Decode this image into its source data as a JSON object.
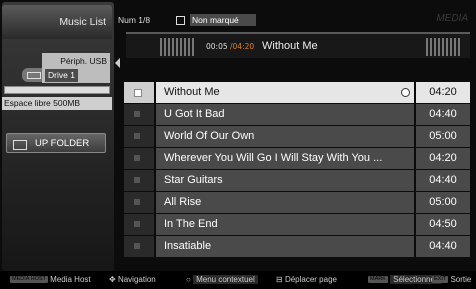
{
  "sidebar": {
    "title": "Music List",
    "device_line1": "Périph. USB",
    "device_line2": "Drive 1",
    "free_space": "Espace libre 500MB",
    "up_folder": "UP FOLDER",
    "icons": {
      "usb": "usb-device-icon",
      "folder": "folder-icon"
    }
  },
  "header": {
    "num": "Num 1/8",
    "mark_label": "Non marqué",
    "brand": "MEDIA"
  },
  "now_playing": {
    "elapsed": "00:05",
    "total": "/04:20",
    "title": "Without Me"
  },
  "tracks": [
    {
      "title": "Without Me",
      "duration": "04:20"
    },
    {
      "title": "U Got It Bad",
      "duration": "04:40"
    },
    {
      "title": "World Of Our Own",
      "duration": "05:00"
    },
    {
      "title": "Wherever You Will Go I Will Stay With You ...",
      "duration": "04:20"
    },
    {
      "title": "Star Guitars",
      "duration": "04:40"
    },
    {
      "title": "All Rise",
      "duration": "05:00"
    },
    {
      "title": "In The End",
      "duration": "04:50"
    },
    {
      "title": "Insatiable",
      "duration": "04:40"
    }
  ],
  "footer": {
    "media_host_tag": "MEDIA HOST",
    "media_host": "Media Host",
    "navigation": "Navigation",
    "context_menu": "Menu contextuel",
    "page_move": "Déplacer page",
    "mark_tag": "MARK",
    "select": "Sélectionner",
    "exit_tag": "EXIT",
    "exit": "Sortie"
  },
  "colors": {
    "highlight_time": "#e08020",
    "selected_row": "#e6e6e6"
  }
}
